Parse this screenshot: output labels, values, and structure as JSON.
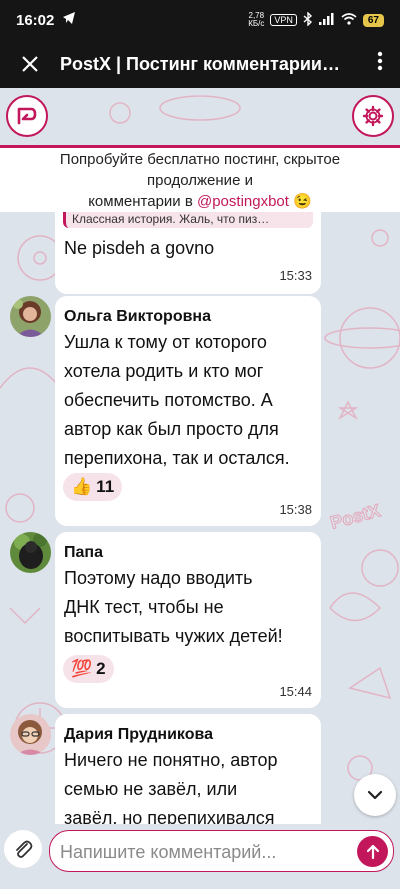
{
  "status_bar": {
    "time": "16:02",
    "net_speed_value": "2,78",
    "net_speed_unit": "КБ/с",
    "vpn": "VPN",
    "battery": "67"
  },
  "app_bar": {
    "title": "PostX | Постинг комментарии…"
  },
  "promo": {
    "line1": "Попробуйте бесплатно постинг, скрытое",
    "line2": "продолжение и",
    "line3_prefix": "комментарии в ",
    "line3_link": "@postingxbot",
    "line3_emoji": "😉"
  },
  "messages": [
    {
      "reply_preview": "Классная история. Жаль, что пиз…",
      "text_lines": [
        "Ne pisdeh a govno"
      ],
      "time": "15:33"
    },
    {
      "author": "Ольга Викторовна",
      "text_lines": [
        "Ушла к тому от которого",
        "хотела родить и кто мог",
        "обеспечить потомство. А",
        "автор как был просто для",
        "перепихона, так и остался."
      ],
      "reaction_emoji": "👍",
      "reaction_count": "11",
      "time": "15:38"
    },
    {
      "author": "Папа",
      "text_lines": [
        "Поэтому надо вводить",
        "ДНК тест, чтобы не",
        "воспитывать чужих детей!"
      ],
      "reaction_emoji": "💯",
      "reaction_count": "2",
      "time": "15:44"
    },
    {
      "author": "Дария Прудникова",
      "text_lines": [
        "Ничего не понятно, автор",
        "семью не завёл, или",
        "завёл, но перепихивался"
      ]
    }
  ],
  "composer": {
    "placeholder": "Напишите комментарий..."
  },
  "colors": {
    "accent": "#c2185b",
    "background": "#dde3ea",
    "bar": "#151515"
  }
}
